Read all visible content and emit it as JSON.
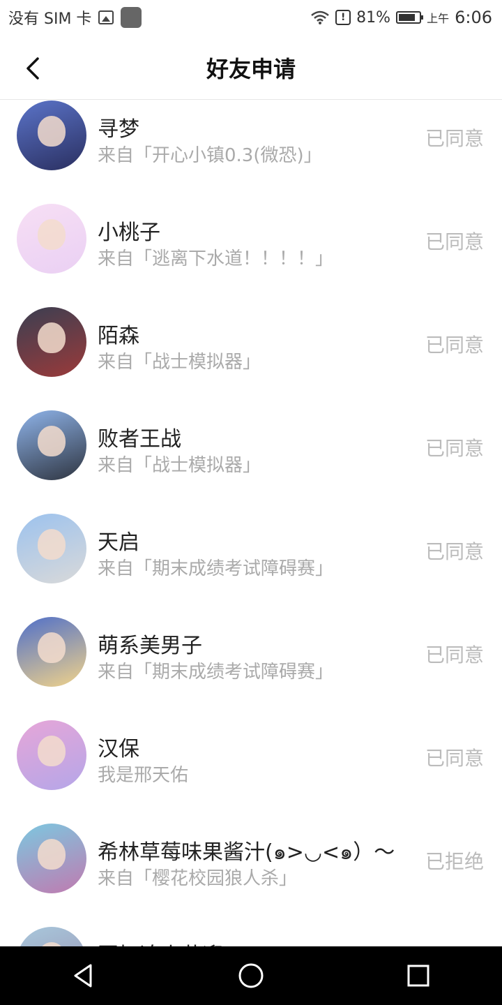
{
  "status_bar": {
    "carrier": "没有 SIM 卡",
    "battery_pct": "81%",
    "ampm": "上午",
    "time": "6:06"
  },
  "header": {
    "title": "好友申请"
  },
  "items": [
    {
      "name": "寻梦",
      "source": "来自「开心小镇0.3(微恐)」",
      "status": "已同意",
      "avatar_colors": [
        "#5b74c9",
        "#2a2f60"
      ]
    },
    {
      "name": "小桃子",
      "source": "来自「逃离下水道！！！！」",
      "status": "已同意",
      "avatar_colors": [
        "#f7dff5",
        "#ead0f3"
      ]
    },
    {
      "name": "陌森",
      "source": "来自「战士模拟器」",
      "status": "已同意",
      "avatar_colors": [
        "#3a3f52",
        "#9b3a3a"
      ]
    },
    {
      "name": "败者王战",
      "source": "来自「战士模拟器」",
      "status": "已同意",
      "avatar_colors": [
        "#8fb4ea",
        "#2e3440"
      ]
    },
    {
      "name": "天启",
      "source": "来自「期末成绩考试障碍赛」",
      "status": "已同意",
      "avatar_colors": [
        "#9cc2ee",
        "#d9d9d9"
      ]
    },
    {
      "name": "萌系美男子",
      "source": "来自「期末成绩考试障碍赛」",
      "status": "已同意",
      "avatar_colors": [
        "#4f6fc9",
        "#f1d38a"
      ]
    },
    {
      "name": "汉保",
      "source": "我是邢天佑",
      "status": "已同意",
      "avatar_colors": [
        "#e6a6d8",
        "#b5a6e8"
      ]
    },
    {
      "name": "希林草莓味果酱汁(๑>◡<๑）～",
      "source": "来自「樱花校园狼人杀」",
      "status": "已拒绝",
      "avatar_colors": [
        "#7cc8e0",
        "#c07ab0"
      ]
    },
    {
      "name": "回忆追山花迎",
      "source": "",
      "status": "",
      "avatar_colors": [
        "#a8c8dc",
        "#9a8fb0"
      ]
    }
  ]
}
